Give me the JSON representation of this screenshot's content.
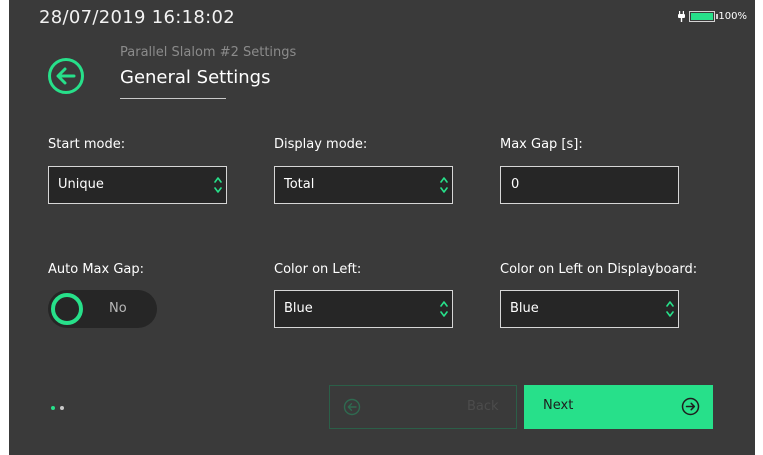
{
  "status_bar": {
    "datetime": "28/07/2019  16:18:02",
    "battery_percent_text": "100%",
    "battery_level": 1.0
  },
  "header": {
    "subtitle": "Parallel Slalom #2 Settings",
    "title": "General Settings"
  },
  "fields": {
    "start_mode": {
      "label": "Start mode:",
      "value": "Unique"
    },
    "display_mode": {
      "label": "Display mode:",
      "value": "Total"
    },
    "max_gap": {
      "label": "Max Gap [s]:",
      "value": "0"
    },
    "auto_max_gap": {
      "label": "Auto Max Gap:",
      "value": "No"
    },
    "color_on_left": {
      "label": "Color on Left:",
      "value": "Blue"
    },
    "color_on_left_displayboard": {
      "label": "Color on Left on Displayboard:",
      "value": "Blue"
    }
  },
  "pager": {
    "pages": 2,
    "current": 1
  },
  "buttons": {
    "back": "Back",
    "next": "Next"
  },
  "colors": {
    "accent": "#27e08a",
    "background": "#3a3a3a",
    "field_bg": "#262626",
    "disabled_text": "#4c4c4c"
  },
  "icons": {
    "header_back": "arrow-left-circle-icon",
    "next": "arrow-right-circle-icon",
    "back": "arrow-left-circle-icon",
    "select": "chevron-up-down-icon",
    "power": "plug-icon",
    "battery": "battery-icon"
  }
}
